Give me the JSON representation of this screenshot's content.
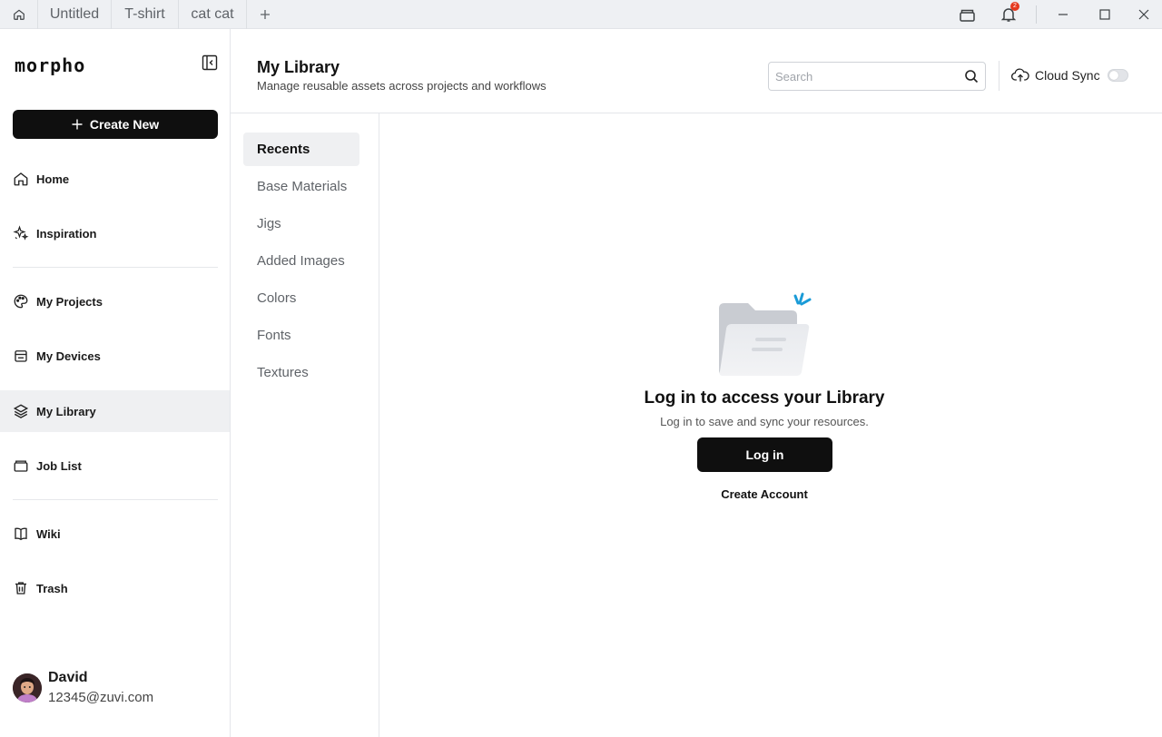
{
  "titlebar": {
    "tabs": [
      {
        "label": "Untitled"
      },
      {
        "label": "T-shirt"
      },
      {
        "label": "cat cat"
      }
    ],
    "notification_count": "2"
  },
  "sidebar": {
    "logo": "morpho",
    "create_label": "Create New",
    "items": [
      {
        "label": "Home",
        "icon": "home-icon"
      },
      {
        "label": "Inspiration",
        "icon": "sparkle-icon"
      },
      {
        "label": "My Projects",
        "icon": "palette-icon"
      },
      {
        "label": "My Devices",
        "icon": "device-icon"
      },
      {
        "label": "My Library",
        "icon": "layers-icon"
      },
      {
        "label": "Job List",
        "icon": "briefcase-icon"
      },
      {
        "label": "Wiki",
        "icon": "book-icon"
      },
      {
        "label": "Trash",
        "icon": "trash-icon"
      }
    ],
    "active_item": "My Library",
    "user": {
      "name": "David",
      "email": "12345@zuvi.com"
    }
  },
  "header": {
    "title": "My Library",
    "subtitle": "Manage reusable assets across projects and workflows",
    "search_placeholder": "Search",
    "cloud_sync_label": "Cloud Sync",
    "cloud_sync_enabled": false
  },
  "library": {
    "categories": [
      {
        "label": "Recents"
      },
      {
        "label": "Base Materials"
      },
      {
        "label": "Jigs"
      },
      {
        "label": "Added Images"
      },
      {
        "label": "Colors"
      },
      {
        "label": "Fonts"
      },
      {
        "label": "Textures"
      }
    ],
    "active_category": "Recents"
  },
  "empty_state": {
    "title": "Log in to access your Library",
    "subtitle": "Log in to save and sync your resources.",
    "login_label": "Log in",
    "create_account_label": "Create Account"
  },
  "colors": {
    "accent": "#0f0f0f",
    "active_bg": "#eff0f2",
    "badge": "#e5391f",
    "sparkle": "#1a9bd7"
  }
}
